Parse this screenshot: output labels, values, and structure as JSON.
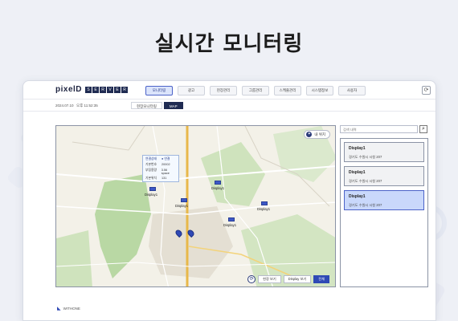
{
  "hero_title": "실시간 모니터링",
  "app": {
    "logo_text": "pixelD",
    "logo_boxes": [
      "S",
      "E",
      "R",
      "V",
      "E",
      "R"
    ],
    "nav": [
      "모니터링",
      "광고",
      "현장관리",
      "그룹관리",
      "스케줄관리",
      "시스템정보",
      "사용자"
    ],
    "active_nav_index": 0,
    "subbar": {
      "date": "2024.07.10",
      "time": "오후 11:52:35",
      "tabs": [
        "현장모니터링",
        "MAP"
      ],
      "active_tab_index": 1
    }
  },
  "map": {
    "notice_label": "내 위치",
    "popup": {
      "head_label": "연결상태",
      "head_value": "● 연결",
      "rows": [
        {
          "k": "기본번호",
          "v": "20002"
        },
        {
          "k": "부팅용량",
          "v": "3.56 space"
        },
        {
          "k": "기본위치",
          "v": "131"
        }
      ]
    },
    "markers": [
      {
        "label": "Display1"
      },
      {
        "label": "Display1"
      },
      {
        "label": "Display1"
      },
      {
        "label": "Display1"
      },
      {
        "label": "Display1"
      }
    ],
    "controls": {
      "round_icon": "refresh-icon",
      "btn1": "현장 보기",
      "btn2": "Display 보기",
      "btn3": "전체"
    }
  },
  "side": {
    "search_placeholder": "검색 내역",
    "items": [
      {
        "name": "Display1",
        "location": "경기도 수원시 시청 207",
        "active": false
      },
      {
        "name": "Display1",
        "location": "경기도 수원시 시청 207",
        "active": false
      },
      {
        "name": "Display1",
        "location": "경기도 수원시 시청 207",
        "active": true
      }
    ]
  },
  "footer": {
    "brand": "WITHONE"
  },
  "colors": {
    "accent": "#2f49b5",
    "navy": "#1f2b52",
    "active_item": "#c9d8fb"
  }
}
